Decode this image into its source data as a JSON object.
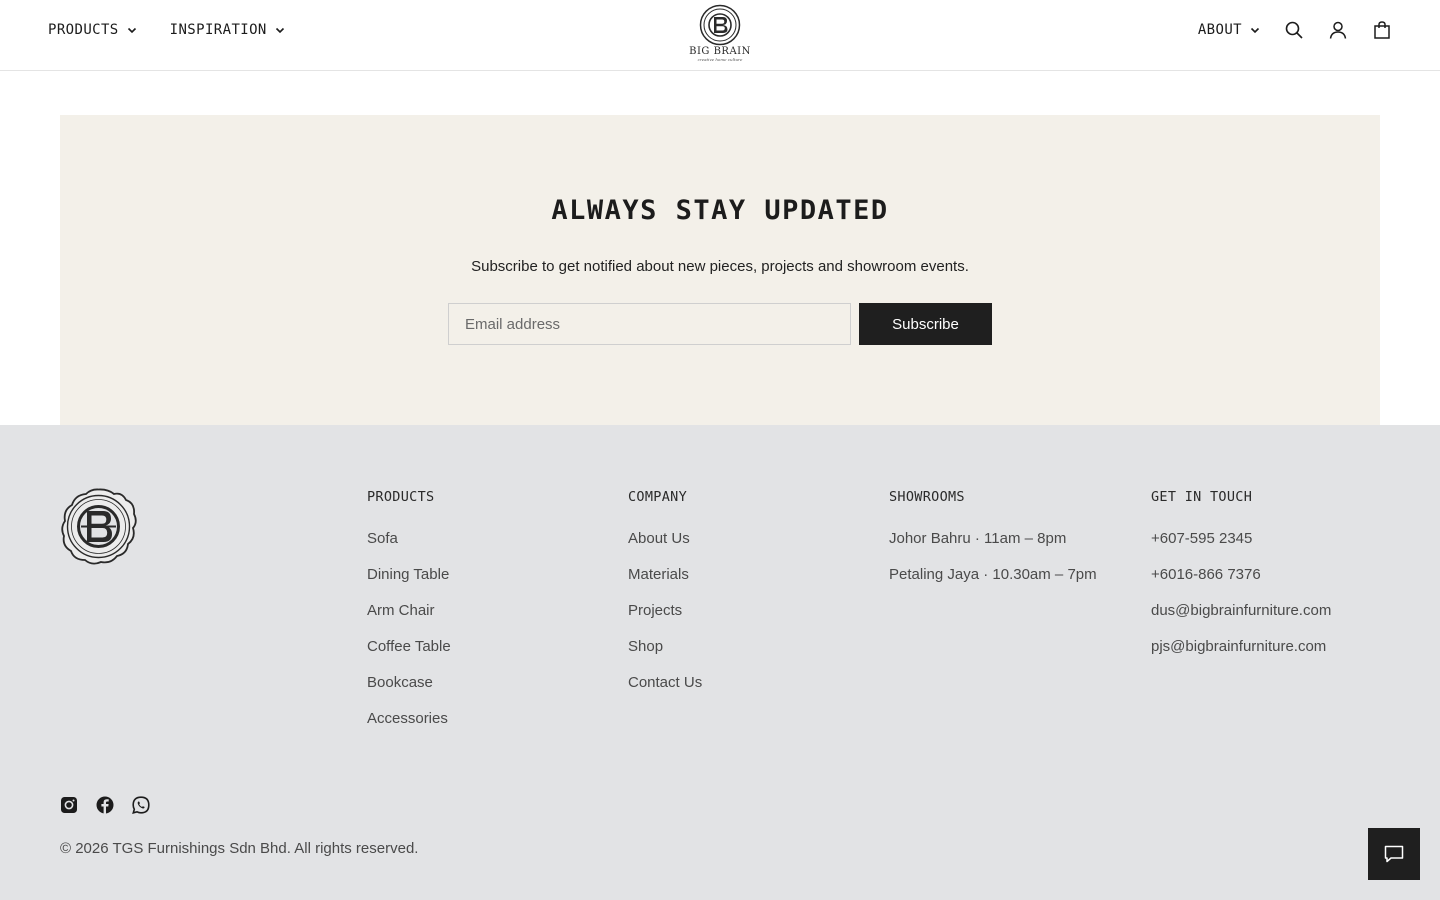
{
  "header": {
    "nav_left": [
      {
        "label": "PRODUCTS",
        "icon": "chevron-down-icon"
      },
      {
        "label": "INSPIRATION",
        "icon": "chevron-down-icon"
      }
    ],
    "logo": {
      "wordmark": "BIG BRAIN",
      "tagline": "creative home culture"
    },
    "about_label": "ABOUT",
    "icons": [
      "search-icon",
      "account-icon",
      "cart-icon"
    ]
  },
  "newsletter": {
    "title": "ALWAYS STAY UPDATED",
    "subtitle": "Subscribe to get notified about new pieces, projects and showroom events.",
    "email_placeholder": "Email address",
    "button_label": "Subscribe"
  },
  "footer": {
    "columns": [
      {
        "title": "PRODUCTS",
        "items": [
          "Sofa",
          "Dining Table",
          "Arm Chair",
          "Coffee Table",
          "Bookcase",
          "Accessories"
        ]
      },
      {
        "title": "COMPANY",
        "items": [
          "About Us",
          "Materials",
          "Projects",
          "Shop",
          "Contact Us"
        ]
      },
      {
        "title": "SHOWROOMS",
        "items": [
          "Johor Bahru · 11am – 8pm",
          "Petaling Jaya · 10.30am – 7pm"
        ]
      },
      {
        "title": "GET IN TOUCH",
        "items": [
          "+607-595 2345",
          "+6016-866 7376",
          "dus@bigbrainfurniture.com",
          "pjs@bigbrainfurniture.com"
        ]
      }
    ],
    "socials": [
      "instagram-icon",
      "facebook-icon",
      "whatsapp-icon"
    ],
    "copyright": "© 2026 TGS Furnishings Sdn Bhd. All rights reserved."
  },
  "chat_icon": "chat-icon",
  "colors": {
    "newsletter_bg": "#f3f0e9",
    "footer_bg": "#e2e3e5",
    "button_bg": "#1f1f1f"
  }
}
